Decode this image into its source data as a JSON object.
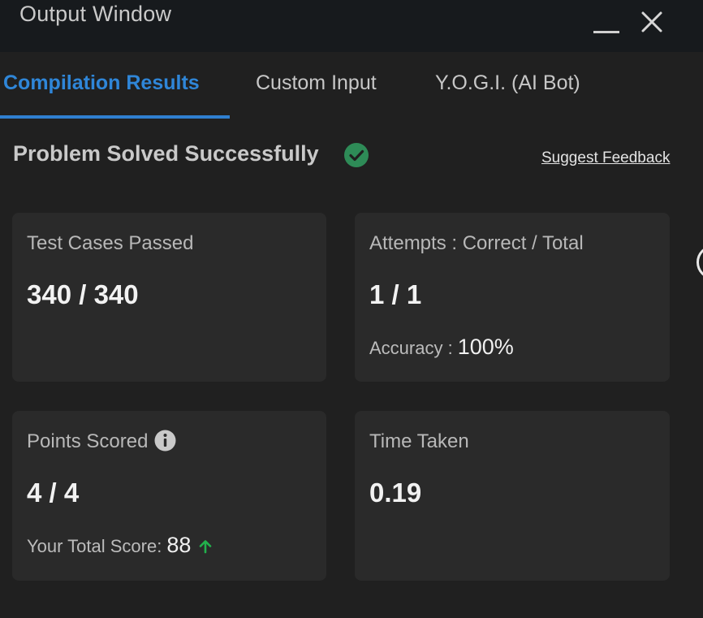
{
  "window": {
    "title": "Output Window",
    "minimize_icon": "minimize-icon",
    "close_icon": "close-icon"
  },
  "tabs": [
    {
      "label": "Compilation Results",
      "active": true
    },
    {
      "label": "Custom Input",
      "active": false
    },
    {
      "label": "Y.O.G.I. (AI Bot)",
      "active": false
    }
  ],
  "status": {
    "title": "Problem Solved Successfully",
    "icon": "check-circle-icon",
    "icon_color": "#2e8b57",
    "feedback_link": "Suggest Feedback"
  },
  "cards": {
    "test_cases": {
      "label": "Test Cases Passed",
      "value": "340 / 340"
    },
    "attempts": {
      "label": "Attempts : Correct / Total",
      "value": "1 / 1",
      "sub_label": "Accuracy :",
      "sub_value": "100%"
    },
    "points": {
      "label": "Points Scored",
      "info_icon": "info-icon",
      "value": "4 / 4",
      "sub_label": "Your Total Score:",
      "sub_value": "88",
      "trend_icon": "arrow-up-icon",
      "trend_color": "#22b14c"
    },
    "time": {
      "label": "Time Taken",
      "value": "0.19"
    }
  },
  "colors": {
    "accent": "#2f86d8",
    "background": "#202020",
    "card": "#2a2a2a",
    "titlebar": "#171a1d"
  }
}
